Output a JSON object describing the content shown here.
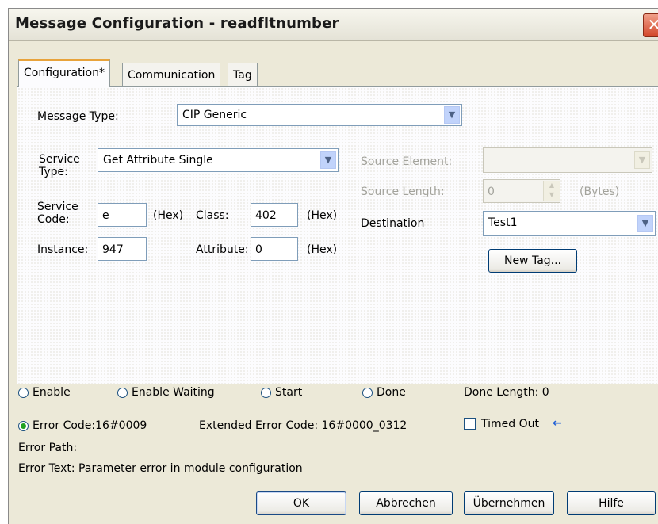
{
  "window": {
    "title": "Message Configuration - readfltnumber",
    "close_glyph": "✕"
  },
  "tabs": [
    {
      "label": "Configuration*"
    },
    {
      "label": "Communication"
    },
    {
      "label": "Tag"
    }
  ],
  "config": {
    "message_type_label": "Message Type:",
    "message_type_value": "CIP Generic",
    "service_type_label_1": "Service",
    "service_type_label_2": "Type:",
    "service_type_value": "Get Attribute Single",
    "service_code_label_1": "Service",
    "service_code_label_2": "Code:",
    "service_code_value": "e",
    "hex_label": "(Hex)",
    "class_label": "Class:",
    "class_value": "402",
    "instance_label": "Instance:",
    "instance_value": "947",
    "attribute_label": "Attribute:",
    "attribute_value": "0",
    "source_element_label": "Source Element:",
    "source_element_value": "",
    "source_length_label": "Source Length:",
    "source_length_value": "0",
    "bytes_label": "(Bytes)",
    "destination_label": "Destination",
    "destination_value": "Test1",
    "new_tag_label": "New Tag...",
    "dropdown_glyph": "▼",
    "spin_up": "▲",
    "spin_down": "▼"
  },
  "status": {
    "enable": "Enable",
    "enable_waiting": "Enable Waiting",
    "start": "Start",
    "done": "Done",
    "done_length": "Done Length: 0",
    "error_code": "Error Code:16#0009",
    "extended_error_code": "Extended Error Code: 16#0000_0312",
    "timed_out": "Timed Out",
    "timed_out_arrow": "←",
    "error_path": "Error Path:",
    "error_text": "Error Text: Parameter error in module configuration",
    "error_selected": true
  },
  "buttons": {
    "ok": "OK",
    "cancel": "Abbrechen",
    "apply": "Übernehmen",
    "help": "Hilfe"
  },
  "colors": {
    "accent_tab": "#e8a33b",
    "close": "#d2462a",
    "radio_on": "#21a121",
    "arrow_blue": "#1f5fd6"
  }
}
